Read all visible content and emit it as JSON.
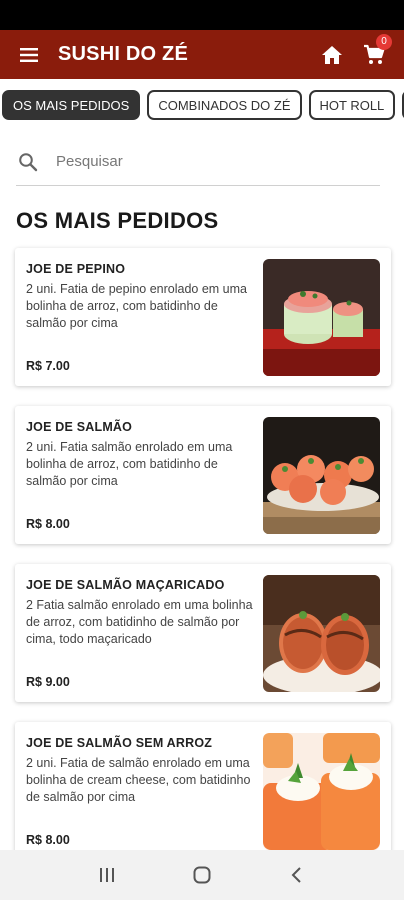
{
  "app": {
    "title": "SUSHI DO ZÉ"
  },
  "cart": {
    "count": "0"
  },
  "tabs": [
    {
      "label": "OS MAIS PEDIDOS",
      "active": true
    },
    {
      "label": "COMBINADOS DO ZÉ",
      "active": false
    },
    {
      "label": "HOT ROLL",
      "active": false
    }
  ],
  "search": {
    "placeholder": "Pesquisar"
  },
  "section": {
    "title": "OS MAIS PEDIDOS"
  },
  "items": [
    {
      "name": "JOE DE PEPINO",
      "description": "2 uni. Fatia de pepino enrolado em uma bolinha de arroz, com batidinho de salmão por cima",
      "price": "R$ 7.00"
    },
    {
      "name": "JOE DE SALMÃO",
      "description": "2 uni. Fatia salmão enrolado em uma bolinha de arroz, com batidinho de salmão por cima",
      "price": "R$ 8.00"
    },
    {
      "name": "JOE DE SALMÃO MAÇARICADO",
      "description": "2 Fatia salmão enrolado em uma bolinha de arroz, com batidinho de salmão por cima, todo maçaricado",
      "price": "R$ 9.00"
    },
    {
      "name": "JOE DE SALMÃO SEM ARROZ",
      "description": "2 uni. Fatia de salmão enrolado em uma bolinha de cream cheese, com batidinho de salmão por cima",
      "price": "R$ 8.00"
    }
  ],
  "icons": {
    "menu": "menu-icon",
    "home": "home-icon",
    "cart": "cart-icon",
    "search": "search-icon",
    "recents": "recents-icon",
    "home_nav": "home-circle-icon",
    "back": "back-icon"
  },
  "colors": {
    "app_bar": "#8a1c0c",
    "badge": "#e53935",
    "active_tab": "#333333"
  }
}
